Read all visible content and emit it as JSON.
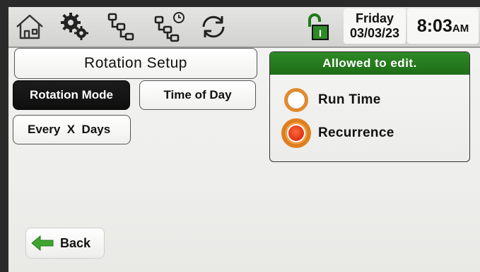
{
  "topbar": {
    "icons": [
      "home-icon",
      "settings-gears-icon",
      "program-tree-icon",
      "schedule-tree-icon",
      "sync-icon",
      "unlocked-padlock-icon"
    ],
    "day": "Friday",
    "date": "03/03/23",
    "time": "8:03",
    "ampm": "AM"
  },
  "left": {
    "title": "Rotation Setup",
    "buttons": {
      "rotation_mode": "Rotation Mode",
      "time_of_day": "Time of Day",
      "every_x_days": "Every  X  Days"
    }
  },
  "edit_panel": {
    "header": "Allowed to edit.",
    "options": [
      {
        "label": "Run Time",
        "selected": false
      },
      {
        "label": "Recurrence",
        "selected": true
      }
    ]
  },
  "back": {
    "label": "Back"
  },
  "colors": {
    "accent_green": "#2e8a26",
    "radio_orange": "#e28a2a",
    "selected_button": "#111111"
  }
}
